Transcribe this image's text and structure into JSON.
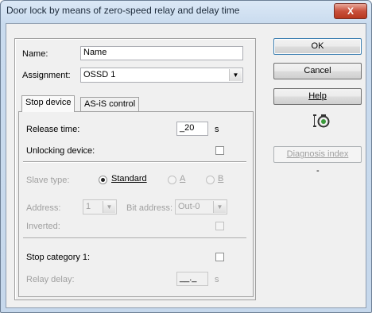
{
  "window": {
    "title": "Door lock by means of zero-speed relay and delay time",
    "close_glyph": "X"
  },
  "form": {
    "name_label": "Name:",
    "name_value": "Name",
    "assignment_label": "Assignment:",
    "assignment_value": "OSSD 1"
  },
  "tabs": [
    {
      "label": "Stop device",
      "active": true
    },
    {
      "label": "AS-iS control",
      "active": false
    }
  ],
  "stop_device": {
    "release_time_label": "Release time:",
    "release_time_value": "_20",
    "release_time_unit": "s",
    "unlocking_label": "Unlocking device:",
    "slave_type_label": "Slave type:",
    "slave_options": [
      "Standard",
      "A",
      "B"
    ],
    "slave_selected": "Standard",
    "address_label": "Address:",
    "address_value": "1",
    "bit_address_label": "Bit address:",
    "bit_address_value": "Out-0",
    "inverted_label": "Inverted:",
    "stop_category_label": "Stop category 1:",
    "relay_delay_label": "Relay delay:",
    "relay_delay_value": "__._",
    "relay_delay_unit": "s"
  },
  "buttons": {
    "ok": "OK",
    "cancel": "Cancel",
    "help": "Help",
    "diagnosis": "Diagnosis index",
    "dash": "-"
  },
  "icons": {
    "status_icon": "key-lock-icon"
  }
}
